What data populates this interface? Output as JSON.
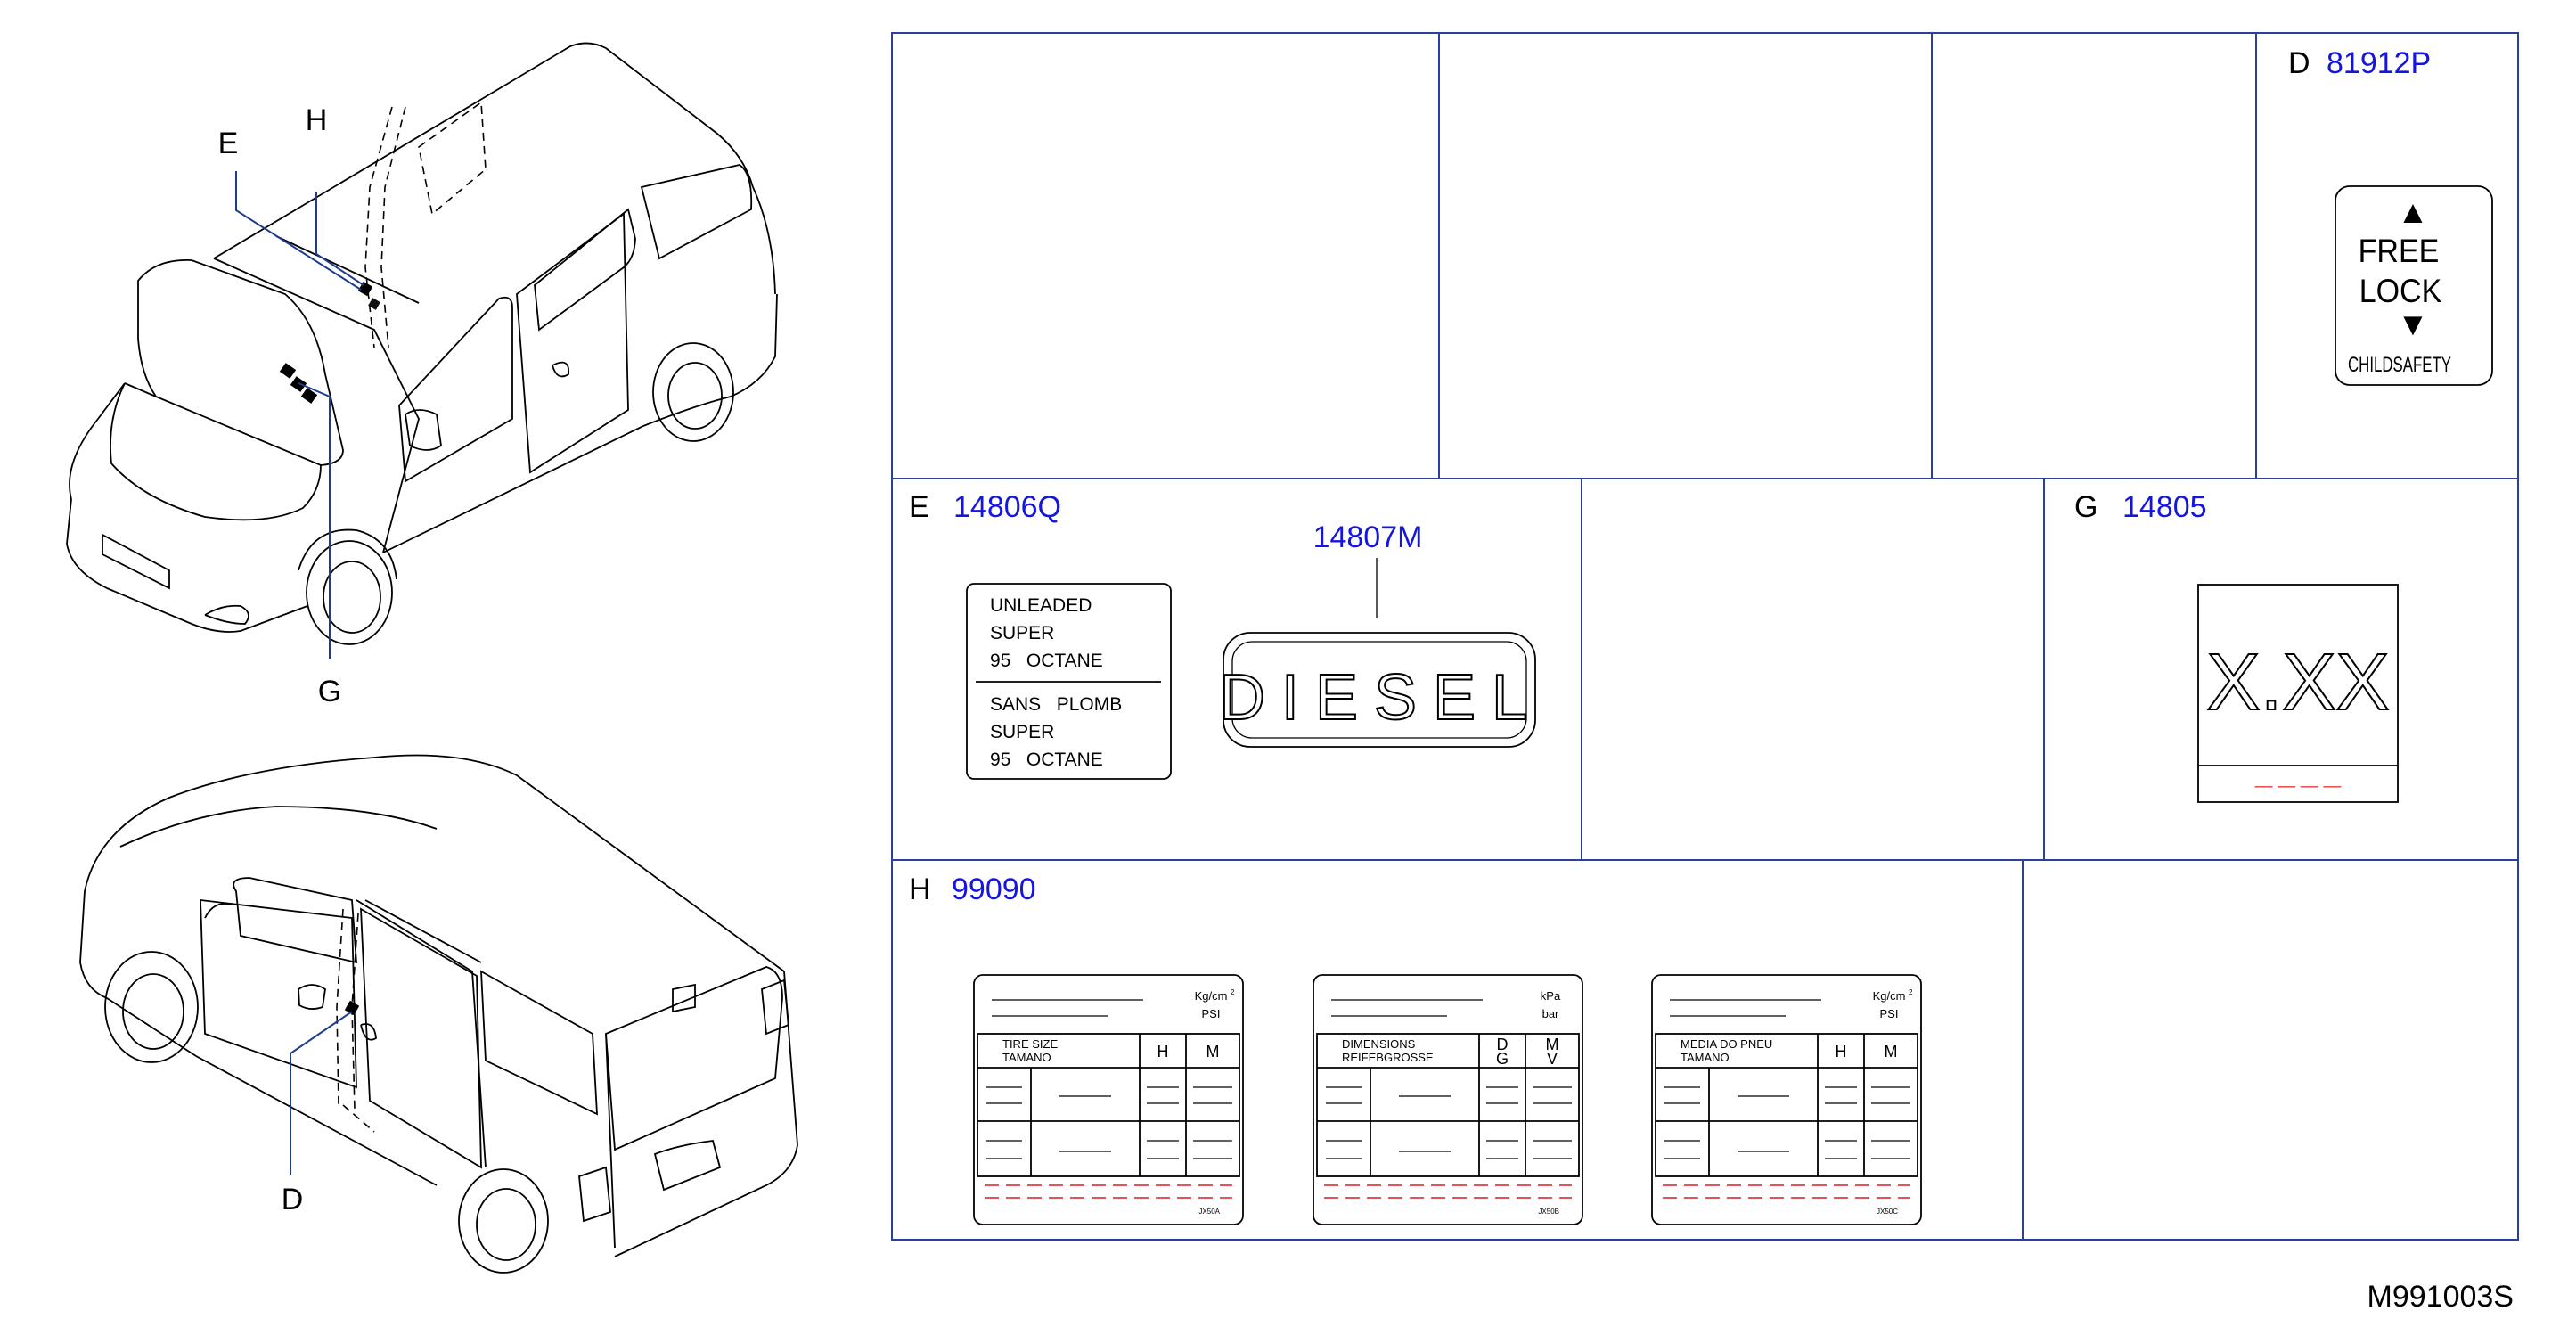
{
  "callouts": {
    "e": "E",
    "h": "H",
    "g": "G",
    "d": "D"
  },
  "panels": {
    "d": {
      "letter": "D",
      "part": "81912P",
      "up_arrow": "▲",
      "line1": "FREE",
      "line2": "LOCK",
      "down_arrow": "▼",
      "line3": "CHILDSAFETY"
    },
    "e": {
      "letter": "E",
      "part": "14806Q",
      "fuel_label": [
        "UNLEADED",
        "SUPER",
        "95   OCTANE",
        "SANS   PLOMB",
        "SUPER",
        "95   OCTANE"
      ],
      "diesel_part": "14807M",
      "diesel_text": "DIESEL"
    },
    "g": {
      "letter": "G",
      "part": "14805",
      "value": "X.XX",
      "dashes": "— — — —"
    },
    "h": {
      "letter": "H",
      "part": "99090",
      "tire_labels": [
        {
          "unit1": "Kg/cm",
          "sup": "2",
          "unit2": "PSI",
          "head1": "TIRE     SIZE",
          "head2": "TAMANO",
          "colA": "H",
          "colB": "M",
          "colA2": "",
          "colB2": "",
          "code": "JX50A"
        },
        {
          "unit1": "kPa",
          "sup": "",
          "unit2": "bar",
          "head1": "DIMENSIONS",
          "head2": "REIFEBGROSSE",
          "colA": "D",
          "colB": "M",
          "colA2": "G",
          "colB2": "V",
          "code": "JX50B"
        },
        {
          "unit1": "Kg/cm",
          "sup": "2",
          "unit2": "PSI",
          "head1": "MEDIA     DO     PNEU",
          "head2": "TAMANO",
          "colA": "H",
          "colB": "M",
          "colA2": "",
          "colB2": "",
          "code": "JX50C"
        }
      ]
    }
  },
  "diagram_code": "M991003S"
}
